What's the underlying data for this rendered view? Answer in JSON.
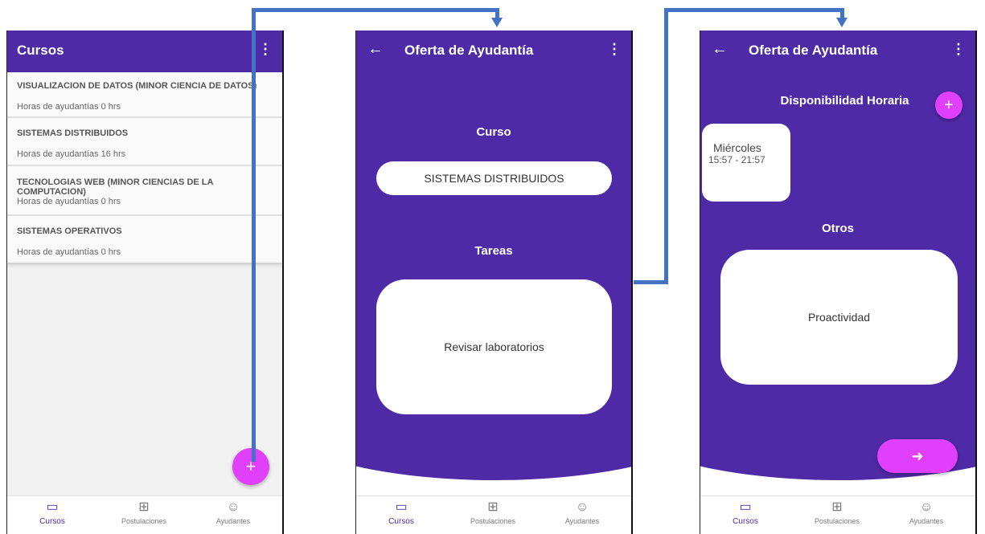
{
  "screen1": {
    "title": "Cursos",
    "courses": [
      {
        "name": "VISUALIZACION DE DATOS (MINOR CIENCIA DE DATOS)",
        "hours": "Horas de ayudantías 0 hrs"
      },
      {
        "name": "SISTEMAS DISTRIBUIDOS",
        "hours": "Horas de ayudantías 16 hrs"
      },
      {
        "name": "TECNOLOGIAS WEB (MINOR CIENCIAS DE LA COMPUTACION)",
        "hours": "Horas de ayudantías 0 hrs"
      },
      {
        "name": "SISTEMAS OPERATIVOS",
        "hours": "Horas de ayudantías 0 hrs"
      }
    ],
    "fab_label": "+"
  },
  "screen2": {
    "title": "Oferta de Ayudantía",
    "curso_label": "Curso",
    "curso_value": "SISTEMAS DISTRIBUIDOS",
    "tareas_label": "Tareas",
    "tareas_value": "Revisar laboratorios"
  },
  "screen3": {
    "title": "Oferta de Ayudantía",
    "disponibilidad_label": "Disponibilidad Horaria",
    "add_label": "+",
    "slot_day": "Miércoles",
    "slot_time": "15:57 - 21:57",
    "otros_label": "Otros",
    "otros_value": "Proactividad",
    "next_label": "➜"
  },
  "nav": {
    "cursos": "Cursos",
    "postulaciones": "Postulaciones",
    "ayudantes": "Ayudantes"
  },
  "icons": {
    "back": "←",
    "menu": "⋮",
    "book": "▭",
    "file": "⊞",
    "group": "☺"
  },
  "colors": {
    "primary": "#4f2aa6",
    "accent": "#e040fb",
    "connector": "#4472c4"
  }
}
